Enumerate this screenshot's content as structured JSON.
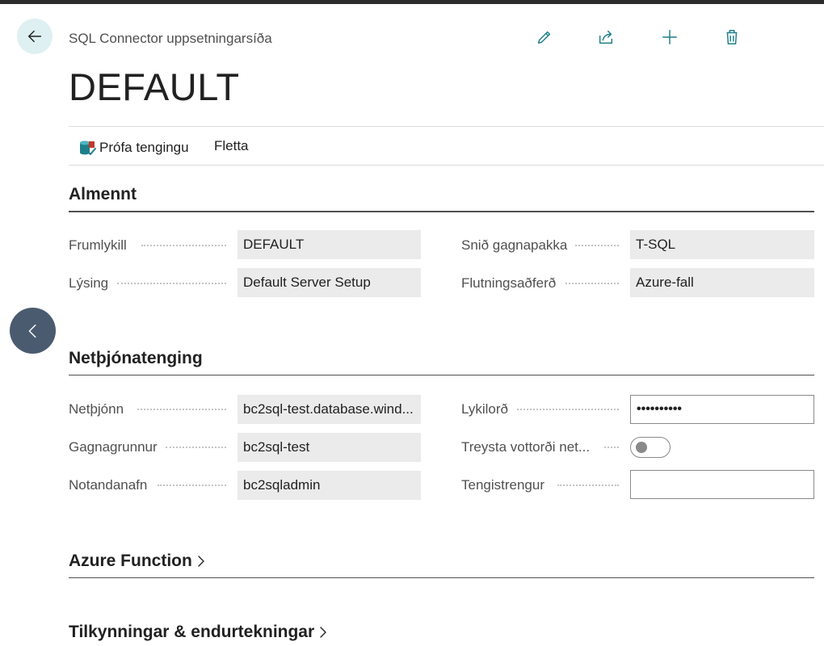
{
  "colors": {
    "accent": "#1e7f8a",
    "back_bg": "#dff0f2",
    "field_bg": "#ebebeb",
    "side_nav": "#4a5b70"
  },
  "header": {
    "breadcrumb": "SQL Connector uppsetningarsíða",
    "title": "DEFAULT",
    "actions": [
      {
        "name": "edit",
        "icon": "pencil-icon"
      },
      {
        "name": "share",
        "icon": "share-icon"
      },
      {
        "name": "new",
        "icon": "plus-icon"
      },
      {
        "name": "delete",
        "icon": "trash-icon"
      }
    ]
  },
  "actionbar": {
    "test_connection": "Prófa tengingu",
    "navigate": "Fletta"
  },
  "general": {
    "title": "Almennt",
    "fields": {
      "primary_key": {
        "label": "Frumlykill",
        "value": "DEFAULT"
      },
      "description": {
        "label": "Lýsing",
        "value": "Default Server Setup"
      },
      "package_format": {
        "label": "Snið gagnapakka",
        "value": "T-SQL"
      },
      "transfer_method": {
        "label": "Flutningsaðferð",
        "value": "Azure-fall"
      }
    }
  },
  "server": {
    "title": "Netþjónatenging",
    "fields": {
      "server": {
        "label": "Netþjónn",
        "value": "bc2sql-test.database.wind..."
      },
      "database": {
        "label": "Gagnagrunnur",
        "value": "bc2sql-test"
      },
      "username": {
        "label": "Notandanafn",
        "value": "bc2sqladmin"
      },
      "password": {
        "label": "Lykilorð",
        "value": "••••••••••"
      },
      "trust_cert": {
        "label": "Treysta vottorði net...",
        "value": false
      },
      "connection_string": {
        "label": "Tengistrengur",
        "value": ""
      }
    }
  },
  "collapsed_sections": [
    {
      "title": "Azure Function"
    },
    {
      "title": "Tilkynningar & endurtekningar"
    }
  ]
}
